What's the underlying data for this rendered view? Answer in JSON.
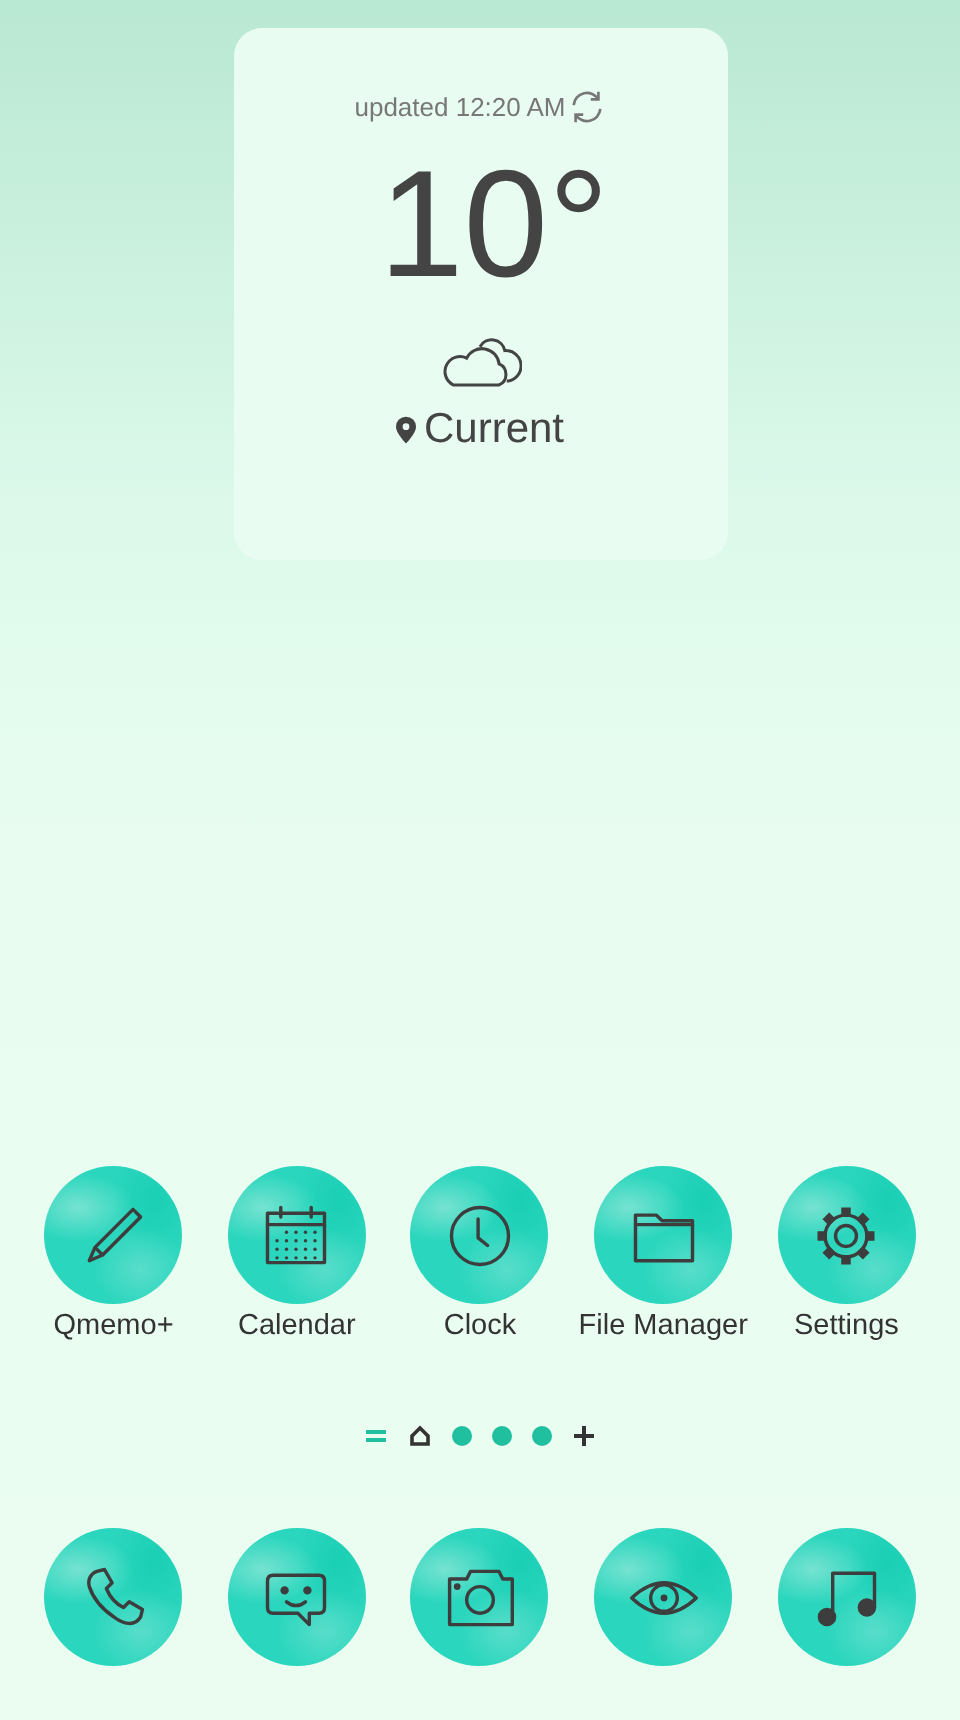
{
  "weather": {
    "updated": "updated 12:20 AM",
    "temperature": "10°",
    "location": "Current"
  },
  "apps": [
    {
      "label": "Qmemo+",
      "kind": "pencil"
    },
    {
      "label": "Calendar",
      "kind": "calendar"
    },
    {
      "label": "Clock",
      "kind": "clock"
    },
    {
      "label": "File Manager",
      "kind": "folder"
    },
    {
      "label": "Settings",
      "kind": "gear"
    }
  ],
  "page_indicator": [
    {
      "kind": "menu"
    },
    {
      "kind": "home"
    },
    {
      "kind": "dot"
    },
    {
      "kind": "dot"
    },
    {
      "kind": "dot"
    },
    {
      "kind": "add"
    }
  ],
  "dock": [
    {
      "kind": "phone"
    },
    {
      "kind": "chat"
    },
    {
      "kind": "camera"
    },
    {
      "kind": "eye"
    },
    {
      "kind": "music"
    }
  ]
}
